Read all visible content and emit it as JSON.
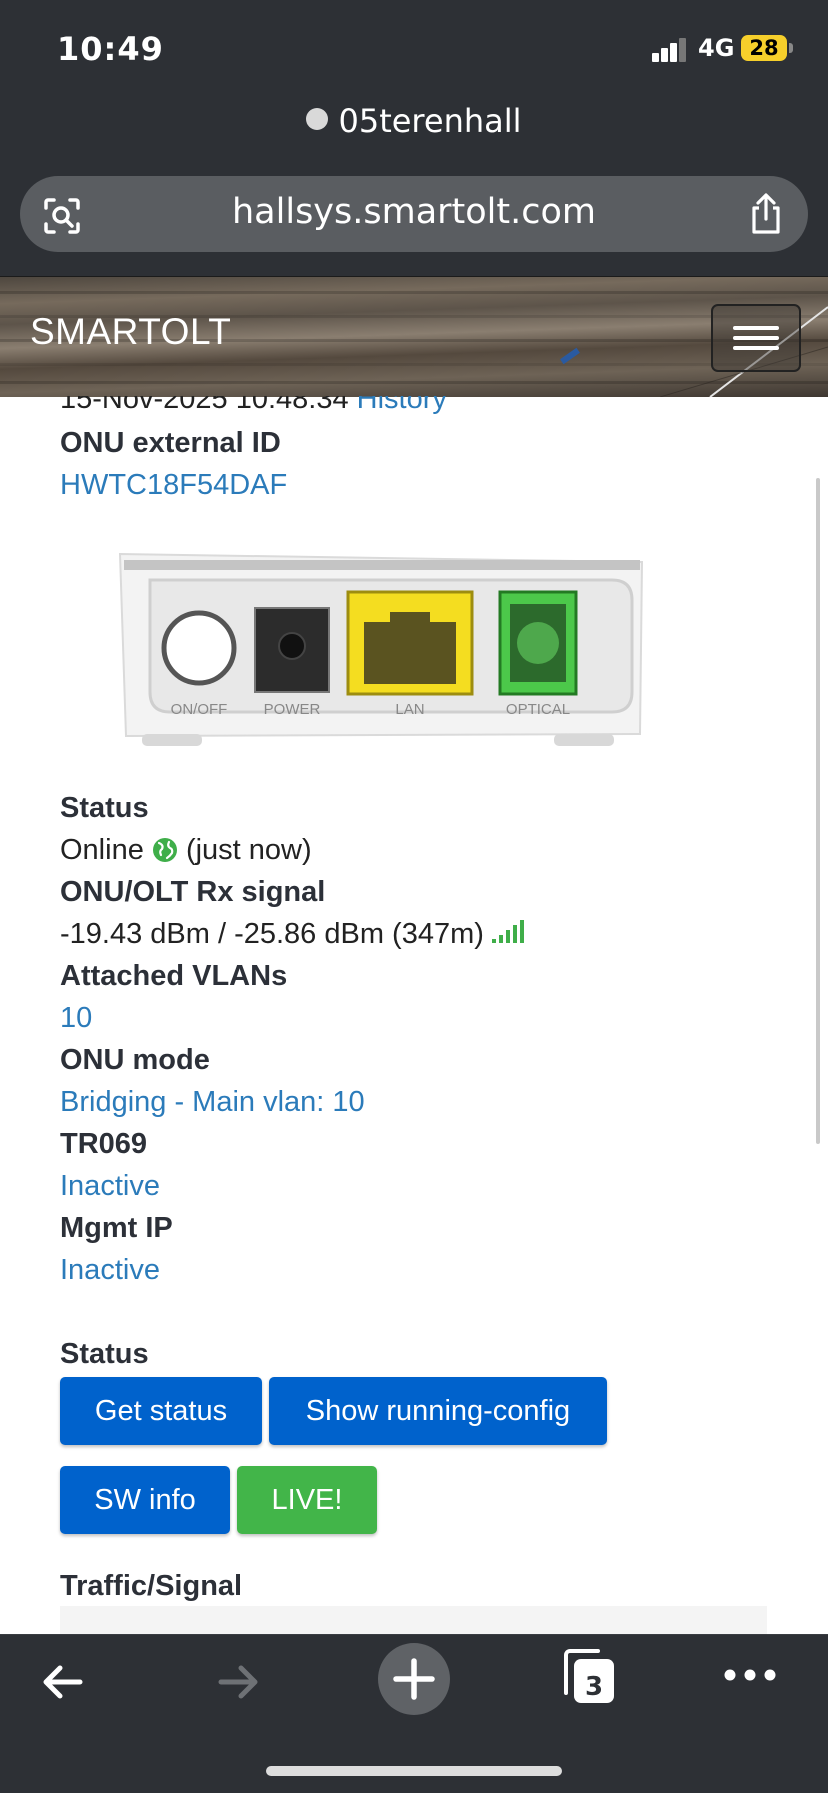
{
  "status_bar": {
    "time": "10:49",
    "network": "4G",
    "battery": "28"
  },
  "browser": {
    "tab_title": "05terenhall",
    "url": "hallsys.smartolt.com",
    "tabs_count": "3"
  },
  "navbar": {
    "brand": "SMARTOLT"
  },
  "details": {
    "timestamp": "15-Nov-2025 10:48:34",
    "history_link": "History",
    "external_id_label": "ONU external ID",
    "external_id_value": "HWTC18F54DAF",
    "device_ports": [
      "ON/OFF",
      "POWER",
      "LAN",
      "OPTICAL"
    ],
    "status_label": "Status",
    "status_value": "Online",
    "status_time": "(just now)",
    "rx_label": "ONU/OLT Rx signal",
    "rx_value": "-19.43 dBm / -25.86 dBm (347m)",
    "vlans_label": "Attached VLANs",
    "vlans_value": "10",
    "mode_label": "ONU mode",
    "mode_value": "Bridging - Main vlan: 10",
    "tr069_label": "TR069",
    "tr069_value": "Inactive",
    "mgmt_label": "Mgmt IP",
    "mgmt_value": "Inactive"
  },
  "actions": {
    "section_label": "Status",
    "get_status": "Get status",
    "show_running_config": "Show running-config",
    "sw_info": "SW info",
    "live": "LIVE!"
  },
  "traffic": {
    "section_label": "Traffic/Signal"
  },
  "colors": {
    "link": "#2b7bba",
    "primary_button": "#0062cc",
    "live_button": "#42b549",
    "chrome": "#2d3035"
  }
}
